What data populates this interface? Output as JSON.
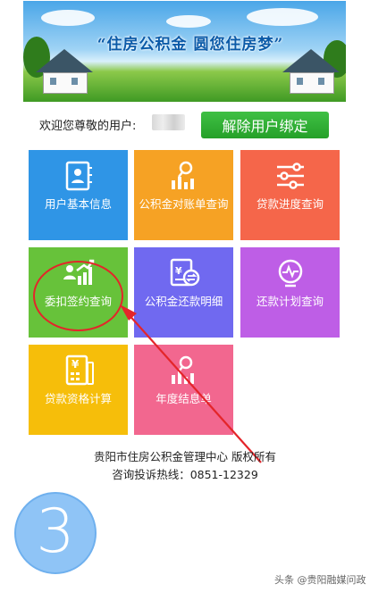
{
  "banner": {
    "slogan": "“住房公积金 圆您住房梦”"
  },
  "welcome": {
    "label": "欢迎您尊敬的用户:"
  },
  "unbind_button": {
    "label": "解除用户绑定"
  },
  "tiles": [
    {
      "label": "用户基本信息",
      "icon": "user-card-icon",
      "color": "#2f95e6"
    },
    {
      "label": "公积金对账单查询",
      "icon": "chart-search-icon",
      "color": "#f6a224"
    },
    {
      "label": "贷款进度查询",
      "icon": "sliders-icon",
      "color": "#f5664a"
    },
    {
      "label": "委扣签约查询",
      "icon": "user-growth-icon",
      "color": "#67c23a"
    },
    {
      "label": "公积金还款明细",
      "icon": "exchange-doc-icon",
      "color": "#7069f0"
    },
    {
      "label": "还款计划查询",
      "icon": "pulse-monitor-icon",
      "color": "#be5ee6"
    },
    {
      "label": "贷款资格计算",
      "icon": "calculator-icon",
      "color": "#f6be0a"
    },
    {
      "label": "年度结息单",
      "icon": "chart-search-icon",
      "color": "#f2678f"
    }
  ],
  "footer": {
    "line1": "贵阳市住房公积金管理中心 版权所有",
    "line2": "咨询投诉热线：0851-12329"
  },
  "step_number": "3",
  "watermark": "头条 @贵阳融媒问政",
  "colors": {
    "accent_red": "#e4252a",
    "button_green": "#2aa52f"
  }
}
